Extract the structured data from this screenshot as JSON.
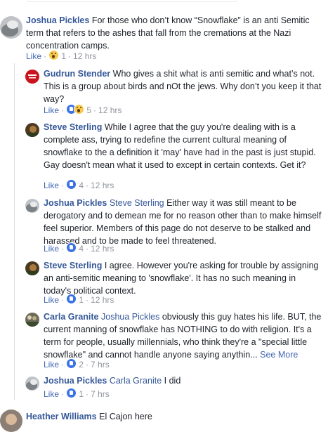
{
  "comments": [
    {
      "author": "Joshua Pickles",
      "mention": "",
      "text": "For those who don’t know “Snowflake” is an anti Semitic term that refers to the ashes that fall from the cremations at the Nazi concentration camps.",
      "like_label": "Like",
      "reaction_icons": [
        "wow-reaction-icon"
      ],
      "reaction_count": "1",
      "time": "12 hrs"
    },
    {
      "author": "Gudrun Stender",
      "mention": "",
      "text": "Who gives a shit what is anti semitic and what’s not. This is a group about birds and nOt the jews. Why don’t you keep it that way?",
      "like_label": "Like",
      "reaction_icons": [
        "like-reaction-icon",
        "wow-reaction-icon"
      ],
      "reaction_count": "5",
      "time": "12 hrs"
    },
    {
      "author": "Steve Sterling",
      "mention": "",
      "text": "While I agree that the guy you're dealing with is a complete ass, trying to redefine the current cultural meaning of snowflake to the a definition it 'may' have had in the past is just stupid. Gay doesn't mean what it used to except in certain contexts. Get it?",
      "like_label": "Like",
      "reaction_icons": [
        "like-reaction-icon"
      ],
      "reaction_count": "4",
      "time": "12 hrs"
    },
    {
      "author": "Joshua Pickles",
      "mention": "Steve Sterling",
      "text": "Either way it was still meant to be derogatory and to demean me for no reason other than to make himself feel superior. Members of this page do not deserve to be stalked and harassed and to be made to feel threatened.",
      "like_label": "Like",
      "reaction_icons": [
        "like-reaction-icon"
      ],
      "reaction_count": "4",
      "time": "12 hrs"
    },
    {
      "author": "Steve Sterling",
      "mention": "",
      "text": "I agree. However you're asking for trouble by assigning an anti-semitic meaning to 'snowflake'. It has no such meaning in today's political context.",
      "like_label": "Like",
      "reaction_icons": [
        "like-reaction-icon"
      ],
      "reaction_count": "1",
      "time": "12 hrs"
    },
    {
      "author": "Carla Granite",
      "mention": "Joshua Pickles",
      "text": "obviously this guy hates his life. BUT, the current manning of snowflake has NOTHING to do with religion. It's a term for people, usually millennials, who think they're a \"special little snowflake\" and cannot handle anyone saying anythin...",
      "see_more": "See More",
      "like_label": "Like",
      "reaction_icons": [
        "like-reaction-icon"
      ],
      "reaction_count": "2",
      "time": "7 hrs"
    },
    {
      "author": "Joshua Pickles",
      "mention": "Carla Granite",
      "text": "I did",
      "like_label": "Like",
      "reaction_icons": [
        "like-reaction-icon"
      ],
      "reaction_count": "1",
      "time": "7 hrs"
    },
    {
      "author": "Heather Williams",
      "mention": "",
      "text": "El Cajon here"
    }
  ]
}
